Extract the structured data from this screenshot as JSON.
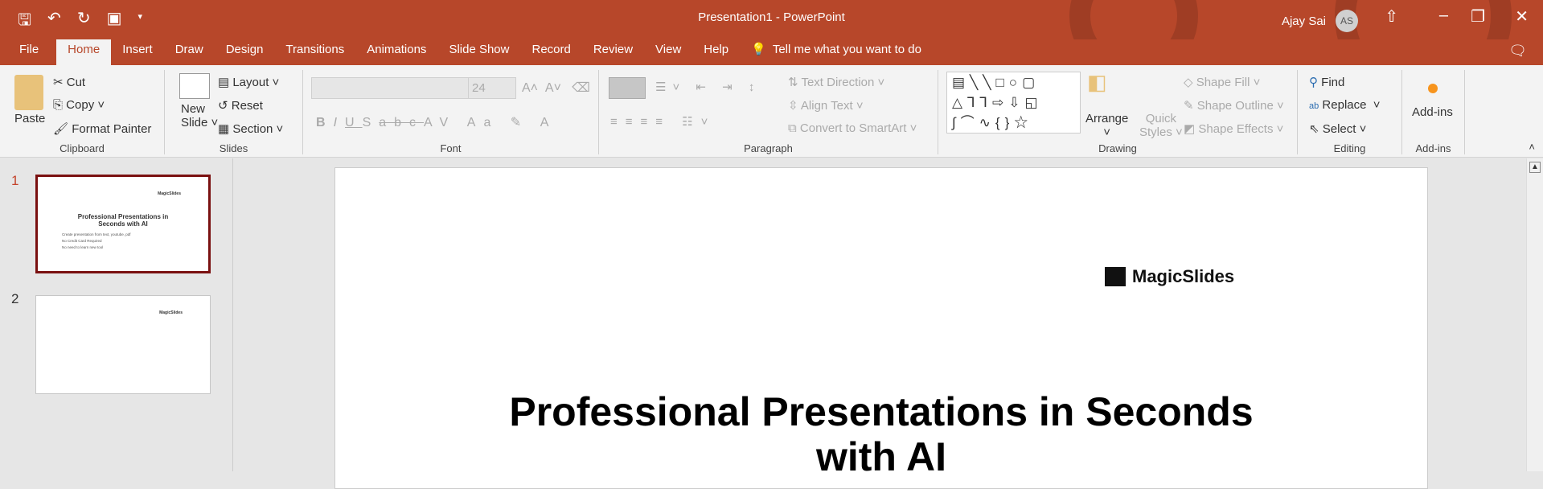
{
  "window": {
    "title": "Presentation1  -  PowerPoint",
    "user": "Ajay Sai",
    "initials": "AS"
  },
  "tabs": [
    "File",
    "Home",
    "Insert",
    "Draw",
    "Design",
    "Transitions",
    "Animations",
    "Slide Show",
    "Record",
    "Review",
    "View",
    "Help"
  ],
  "tell_me": "Tell me what you want to do",
  "ribbon": {
    "clipboard": {
      "label": "Clipboard",
      "paste": "Paste",
      "cut": "Cut",
      "copy": "Copy",
      "format_painter": "Format Painter"
    },
    "slides": {
      "label": "Slides",
      "new_slide": "New",
      "new_slide2": "Slide",
      "layout": "Layout",
      "reset": "Reset",
      "section": "Section"
    },
    "font": {
      "label": "Font",
      "size": "24"
    },
    "paragraph": {
      "label": "Paragraph",
      "text_direction": "Text Direction",
      "align_text": "Align Text",
      "convert": "Convert to SmartArt"
    },
    "drawing": {
      "label": "Drawing",
      "arrange": "Arrange",
      "quick": "Quick",
      "styles": "Styles",
      "fill": "Shape Fill",
      "outline": "Shape Outline",
      "effects": "Shape Effects"
    },
    "editing": {
      "label": "Editing",
      "find": "Find",
      "replace": "Replace",
      "select": "Select"
    },
    "addins": {
      "label": "Add-ins",
      "button": "Add-ins"
    }
  },
  "thumbnails": [
    {
      "num": "1",
      "logo": "MagicSlides",
      "title": "Professional Presentations in Seconds with AI",
      "bullets": [
        "Create presentation from text, youtube, pdf",
        "No Credit Card Required",
        "No need to learn new tool"
      ]
    },
    {
      "num": "2",
      "logo": "MagicSlides"
    }
  ],
  "slide": {
    "logo": "MagicSlides",
    "title_line1": "Professional Presentations in Seconds",
    "title_line2": "with AI"
  }
}
